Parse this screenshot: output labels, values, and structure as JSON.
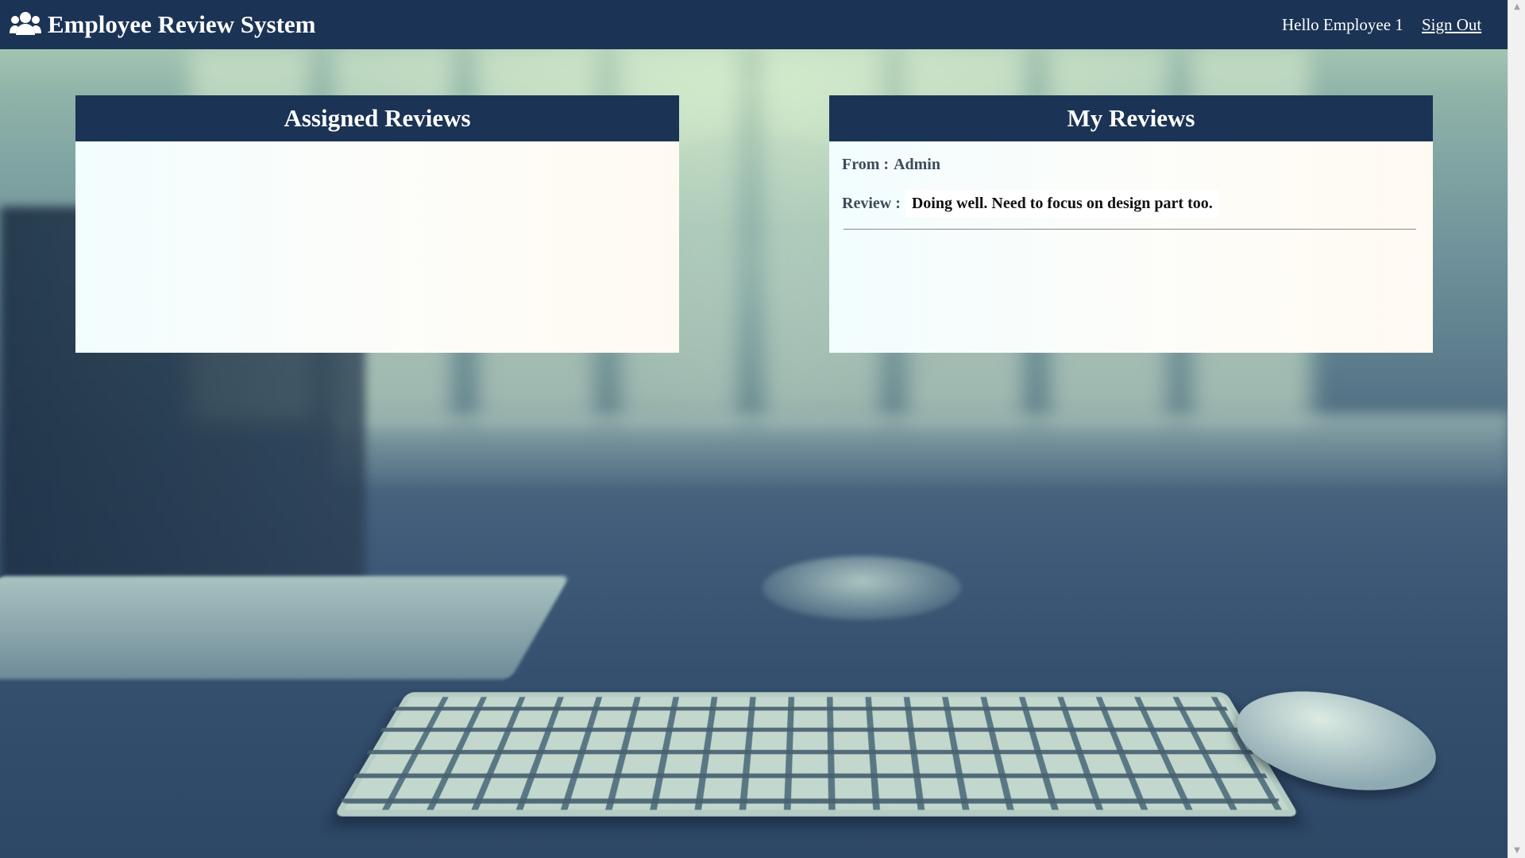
{
  "app": {
    "title": "Employee Review System",
    "brand_icon": "users-icon"
  },
  "header": {
    "greeting": "Hello Employee 1",
    "signout_label": "Sign Out"
  },
  "panels": {
    "assigned": {
      "title": "Assigned Reviews",
      "items": []
    },
    "mine": {
      "title": "My Reviews",
      "reviews": [
        {
          "from_label": "From :",
          "from": "Admin",
          "review_label": "Review :",
          "text": "Doing well. Need to focus on design part too."
        }
      ]
    }
  },
  "colors": {
    "navbar": "#1b3355",
    "panel_header": "#1b3355",
    "panel_body": "#fdfdf9"
  }
}
